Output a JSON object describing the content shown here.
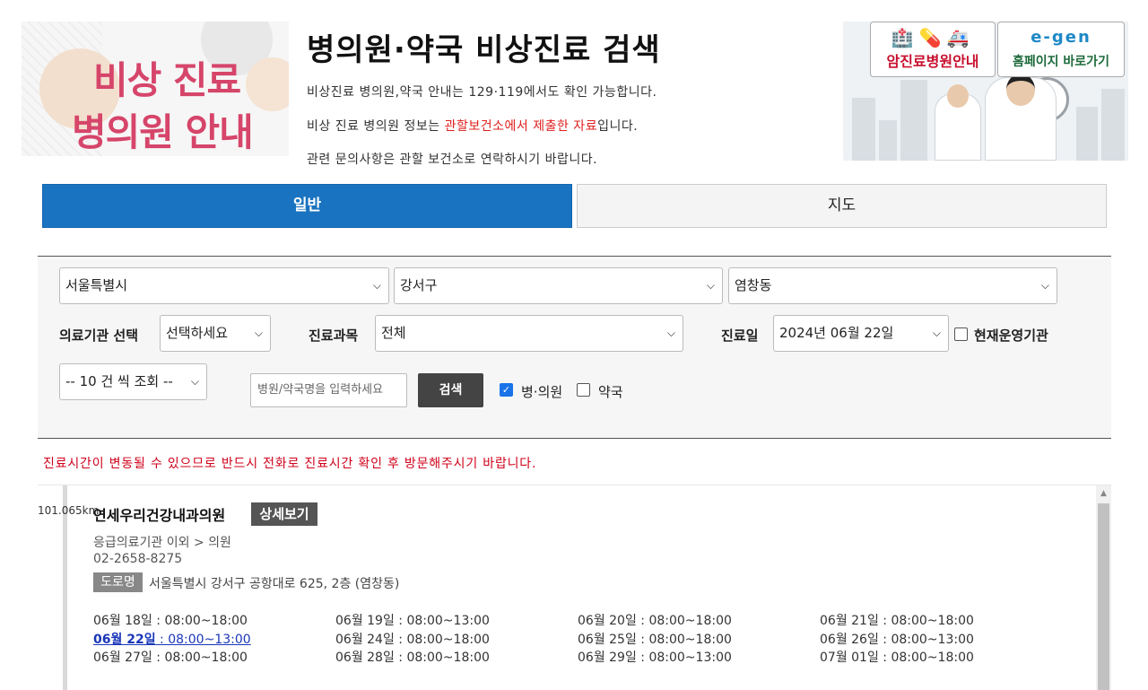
{
  "banner_left": {
    "line1": "비상 진료",
    "line2": "병의원 안내"
  },
  "header": {
    "title": "병의원·약국 비상진료 검색",
    "info1": "비상진료 병의원,약국 안내는 129·119에서도 확인 가능합니다.",
    "info2_pre": "비상 진료 병의원 정보는 ",
    "info2_red": "관할보건소에서 제출한 자료",
    "info2_post": "입니다.",
    "info3": "관련 문의사항은 관할 보건소로 연락하시기 바랍니다."
  },
  "banner_right": {
    "cancer_label": "암진료병원안내",
    "home_label": "홈페이지 바로가기",
    "home_logo": "e-gen"
  },
  "tabs": [
    {
      "label": "일반",
      "active": true
    },
    {
      "label": "지도",
      "active": false
    }
  ],
  "search": {
    "city": "서울특별시",
    "district": "강서구",
    "dong": "염창동",
    "facility_label": "의료기관 선택",
    "facility_value": "선택하세요",
    "dept_label": "진료과목",
    "dept_value": "전체",
    "date_label": "진료일",
    "date_value": "2024년 06월 22일",
    "operating_label": "현재운영기관",
    "page_size": "-- 10 건 씩 조회 --",
    "name_placeholder": "병원/약국명을 입력하세요",
    "search_button": "검색",
    "clinic_label": "병·의원",
    "pharmacy_label": "약국"
  },
  "notice": "진료시간이 변동될 수 있으므로 반드시 전화로 진료시간 확인 후 방문해주시기 바랍니다.",
  "result": {
    "distance": "101.065km",
    "name": "연세우리건강내과의원",
    "detail_button": "상세보기",
    "category": "응급의료기관 이외 > 의원",
    "phone": "02-2658-8275",
    "road_badge": "도로명",
    "address": "서울특별시 강서구 공항대로 625, 2층 (염창동)",
    "hours": [
      "06월 18일 : 08:00~18:00",
      "06월 19일 : 08:00~13:00",
      "06월 20일 : 08:00~18:00",
      "06월 21일 : 08:00~18:00",
      "06월 22일 : 08:00~13:00",
      "06월 24일 : 08:00~18:00",
      "06월 25일 : 08:00~18:00",
      "06월 26일 : 08:00~13:00",
      "06월 27일 : 08:00~18:00",
      "06월 28일 : 08:00~18:00",
      "06월 29일 : 08:00~13:00",
      "07월 01일 : 08:00~18:00"
    ],
    "today_day": "06월 22일",
    "today_time": " : 08:00~13:00"
  },
  "colors": {
    "accent": "#1a73c0",
    "alert": "#d0021b",
    "banner_pink": "#d6456a"
  }
}
